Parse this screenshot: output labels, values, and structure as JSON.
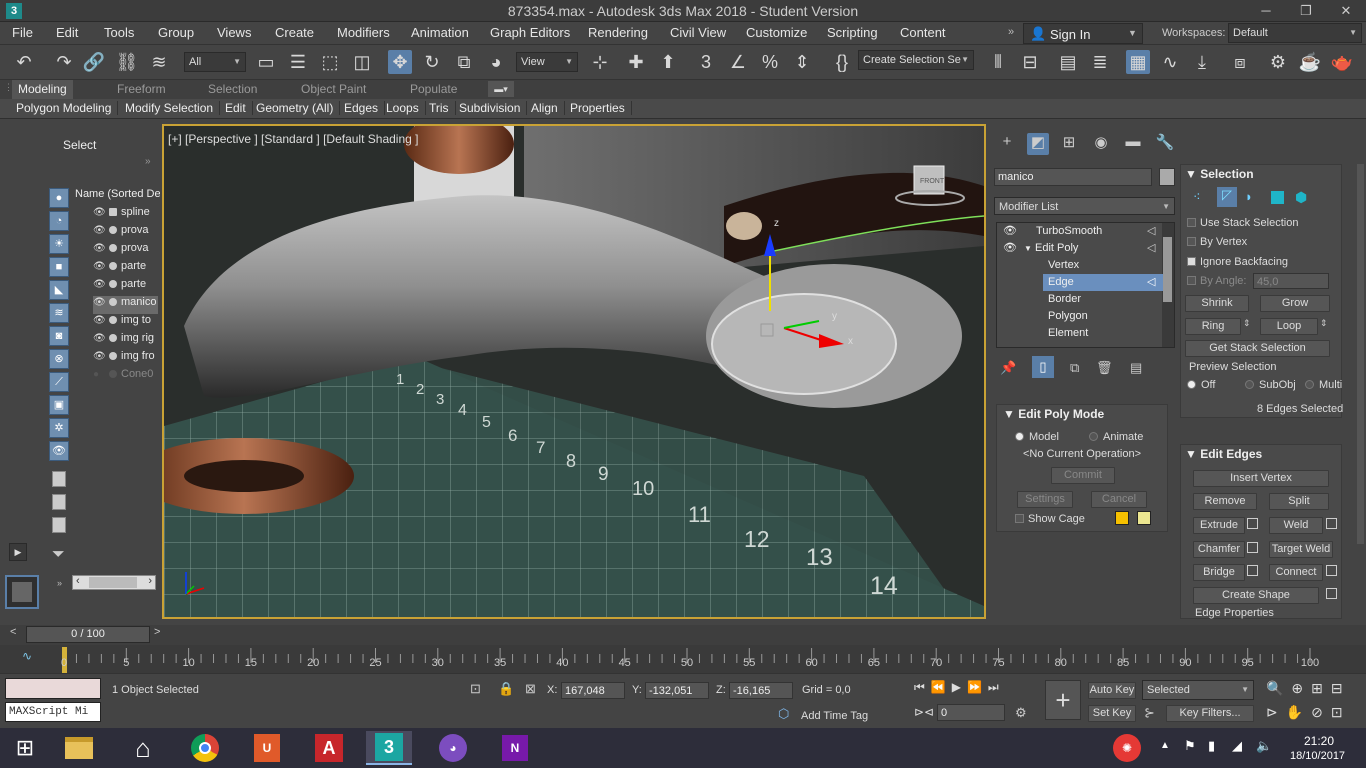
{
  "window": {
    "title": "873354.max - Autodesk 3ds Max 2018 - Student Version",
    "minimize": "─",
    "restore": "❐",
    "close": "✕"
  },
  "menu": [
    "File",
    "Edit",
    "Tools",
    "Group",
    "Views",
    "Create",
    "Modifiers",
    "Animation",
    "Graph Editors",
    "Rendering",
    "Civil View",
    "Customize",
    "Scripting",
    "Content"
  ],
  "signin": "Sign In",
  "workspaces_label": "Workspaces:",
  "workspaces_value": "Default",
  "toolbar": {
    "filter": "All",
    "refcoord": "View",
    "selset": "Create Selection Se"
  },
  "ribbon": {
    "tabs": [
      "Modeling",
      "Freeform",
      "Selection",
      "Object Paint",
      "Populate"
    ],
    "active": "Modeling"
  },
  "ribbon_sub": [
    "Polygon Modeling",
    "Modify Selection",
    "Edit",
    "Geometry (All)",
    "Edges",
    "Loops",
    "Tris",
    "Subdivision",
    "Align",
    "Properties"
  ],
  "scene": {
    "select_label": "Select",
    "column": "Name (Sorted De",
    "rows": [
      "spline",
      "prova",
      "prova",
      "parte",
      "parte",
      "manico",
      "img to",
      "img rig",
      "img fro",
      "Cone0"
    ],
    "selected_index": 5
  },
  "viewport": {
    "label": "[+] [Perspective ] [Standard ] [Default Shading ]",
    "viewcube": "FRONT",
    "ruler": [
      "1",
      "2",
      "3",
      "4",
      "5",
      "6",
      "7",
      "8",
      "9",
      "10",
      "11",
      "12",
      "13",
      "14"
    ],
    "axis_x": "x",
    "axis_y": "y",
    "axis_z": "z"
  },
  "cmd": {
    "object_name": "manico",
    "modifier_list": "Modifier List",
    "stack": [
      "TurboSmooth",
      "Edit Poly",
      "Vertex",
      "Edge",
      "Border",
      "Polygon",
      "Element"
    ],
    "stack_selected": "Edge",
    "editpoly_mode": {
      "title": "Edit Poly Mode",
      "model": "Model",
      "animate": "Animate",
      "op": "<No Current Operation>",
      "commit": "Commit",
      "settings": "Settings",
      "cancel": "Cancel",
      "show_cage": "Show Cage"
    },
    "selection": {
      "title": "Selection",
      "use_stack": "Use Stack Selection",
      "by_vertex": "By Vertex",
      "ignore_backfacing": "Ignore Backfacing",
      "by_angle": "By Angle:",
      "angle": "45,0",
      "shrink": "Shrink",
      "grow": "Grow",
      "ring": "Ring",
      "loop": "Loop",
      "get_stack": "Get Stack Selection",
      "preview": "Preview Selection",
      "off": "Off",
      "subobj": "SubObj",
      "multi": "Multi",
      "status": "8 Edges Selected"
    },
    "edit_edges": {
      "title": "Edit Edges",
      "insert_vertex": "Insert Vertex",
      "remove": "Remove",
      "split": "Split",
      "extrude": "Extrude",
      "weld": "Weld",
      "chamfer": "Chamfer",
      "target_weld": "Target Weld",
      "bridge": "Bridge",
      "connect": "Connect",
      "create_shape": "Create Shape",
      "edge_props": "Edge Properties"
    }
  },
  "timeline": {
    "counter": "0 / 100",
    "ticks": [
      "0",
      "5",
      "10",
      "15",
      "20",
      "25",
      "30",
      "35",
      "40",
      "45",
      "50",
      "55",
      "60",
      "65",
      "70",
      "75",
      "80",
      "85",
      "90",
      "95",
      "100"
    ]
  },
  "status": {
    "maxscript": "MAXScript Mi",
    "selected": "1 Object Selected",
    "x_label": "X:",
    "x": "167,048",
    "y_label": "Y:",
    "y": "-132,051",
    "z_label": "Z:",
    "z": "-16,165",
    "grid": "Grid = 0,0",
    "add_time_tag": "Add Time Tag",
    "auto_key": "Auto Key",
    "set_key": "Set Key",
    "key_mode": "Selected",
    "key_filters": "Key Filters...",
    "frame": "0"
  },
  "taskbar": {
    "time": "21:20",
    "date": "18/10/2017"
  },
  "colors": {
    "accent": "#5a7fa8",
    "viewport_border": "#c9a235",
    "selected": "#6a8fbe"
  }
}
